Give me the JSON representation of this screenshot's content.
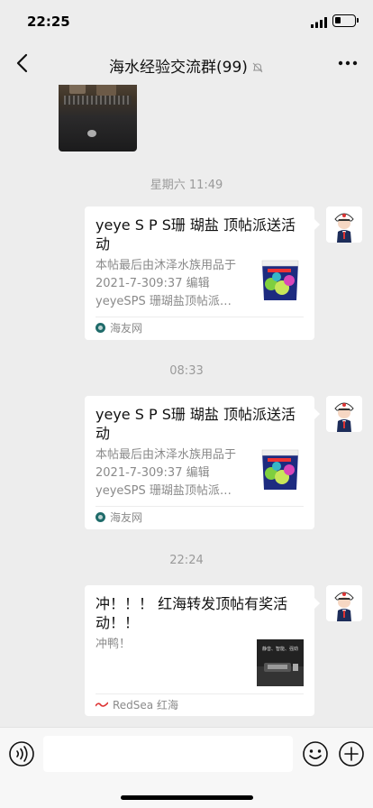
{
  "status_bar": {
    "time": "22:25",
    "battery_level": 0.25
  },
  "nav": {
    "title": "海水经验交流群(99)",
    "back_icon": "chevron-left-icon",
    "mute_icon": "bell-slash-icon",
    "more_icon": "more-horizontal-icon"
  },
  "messages": [
    {
      "timestamp": "星期六 11:49",
      "title": "yeye S P S珊 瑚盐 顶帖派送活动",
      "desc": "本帖最后由沐泽水族用品于 2021-7-309:37 编辑 yeyeSPS 珊瑚盐顶帖派…",
      "source": "海友网"
    },
    {
      "timestamp": "08:33",
      "title": "yeye S P S珊 瑚盐 顶帖派送活动",
      "desc": "本帖最后由沐泽水族用品于 2021-7-309:37 编辑 yeyeSPS 珊瑚盐顶帖派…",
      "source": "海友网"
    },
    {
      "timestamp": "22:24",
      "title": "冲！！！ 红海转发顶帖有奖活动！！",
      "desc": "冲鸭！",
      "source": "RedSea 红海",
      "thumb_text": "静音、智能、强劲"
    }
  ],
  "input_bar": {
    "voice_icon": "voice-icon",
    "emoji_icon": "emoji-icon",
    "add_icon": "plus-circle-icon"
  },
  "colors": {
    "background": "#ededed",
    "card": "#ffffff",
    "meta_text": "#9a9a9a"
  }
}
